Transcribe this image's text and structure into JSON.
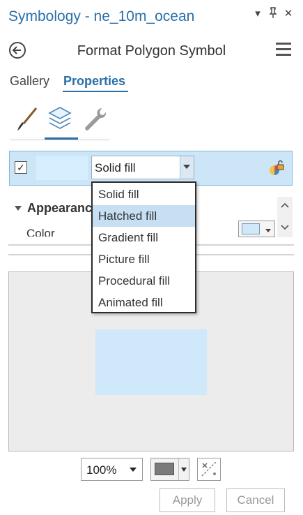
{
  "window": {
    "title": "Symbology - ne_10m_ocean",
    "pin_glyph": "⊓",
    "dropdown_glyph": "▾",
    "close_glyph": "✕"
  },
  "header": {
    "subtitle": "Format Polygon Symbol"
  },
  "tabs": [
    {
      "label": "Gallery",
      "active": false
    },
    {
      "label": "Properties",
      "active": true
    }
  ],
  "icon_tabs": [
    {
      "icon": "paintbrush-icon",
      "selected": false
    },
    {
      "icon": "layers-icon",
      "selected": true
    },
    {
      "icon": "wrench-icon",
      "selected": false
    }
  ],
  "layer": {
    "checked": true,
    "check_glyph": "✓",
    "fill_color": "#d6efff",
    "fill_type": "Solid fill"
  },
  "dropdown": {
    "options": [
      "Solid fill",
      "Hatched fill",
      "Gradient fill",
      "Picture fill",
      "Procedural fill",
      "Animated fill"
    ],
    "highlighted": "Hatched fill"
  },
  "appearance": {
    "section_label": "Appearanc",
    "color_label": "Color",
    "color_value": "#cfe9fb"
  },
  "preview": {
    "fill_color": "#cfe9fb"
  },
  "footer": {
    "zoom": "100%",
    "background_color": "#7a7a7a",
    "apply_label": "Apply",
    "cancel_label": "Cancel"
  },
  "colors": {
    "accent": "#2a6fa8",
    "selected_row": "#cde6f7",
    "highlight": "#c6dff2"
  }
}
